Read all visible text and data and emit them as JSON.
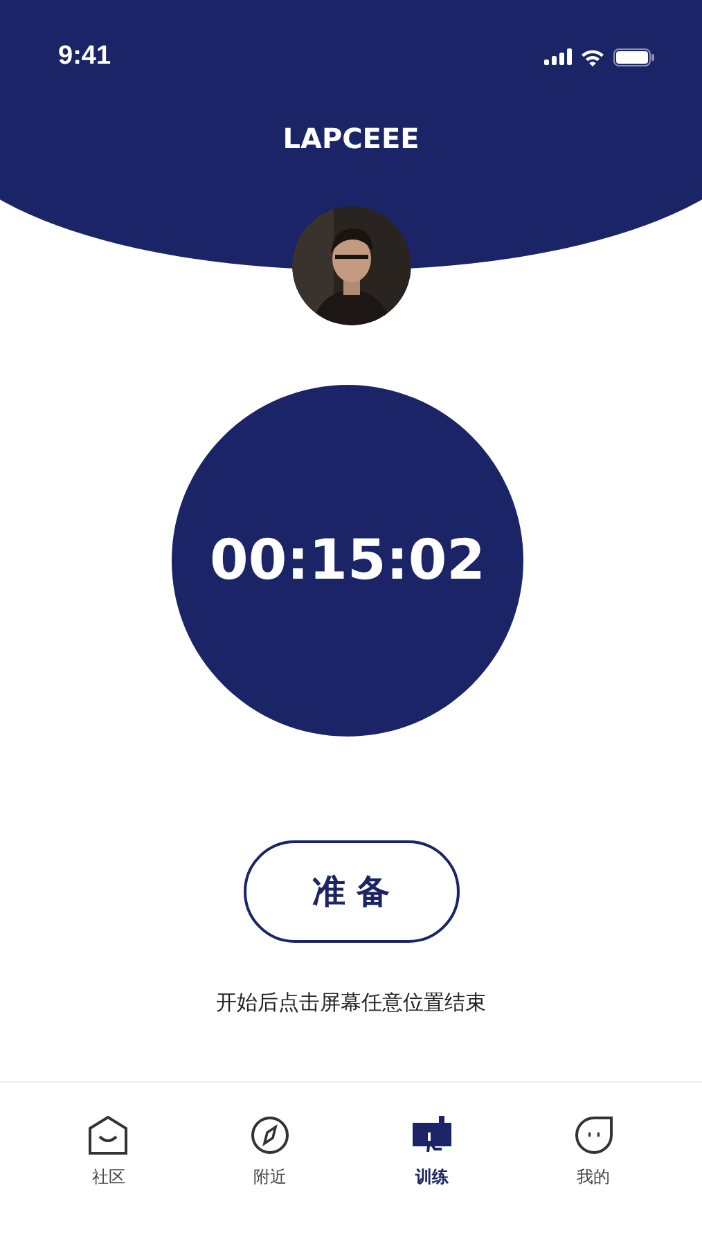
{
  "status_bar": {
    "time": "9:41"
  },
  "header": {
    "title": "LAPCEEE"
  },
  "timer": {
    "value": "00:15:02"
  },
  "ready_button": {
    "label": "准 备"
  },
  "hint": "开始后点击屏幕任意位置结束",
  "tabs": [
    {
      "label": "社区",
      "kind": "home",
      "selected": false
    },
    {
      "label": "附近",
      "kind": "compass",
      "selected": false
    },
    {
      "label": "训练",
      "kind": "train",
      "selected": true
    },
    {
      "label": "我的",
      "kind": "face",
      "selected": false
    }
  ]
}
